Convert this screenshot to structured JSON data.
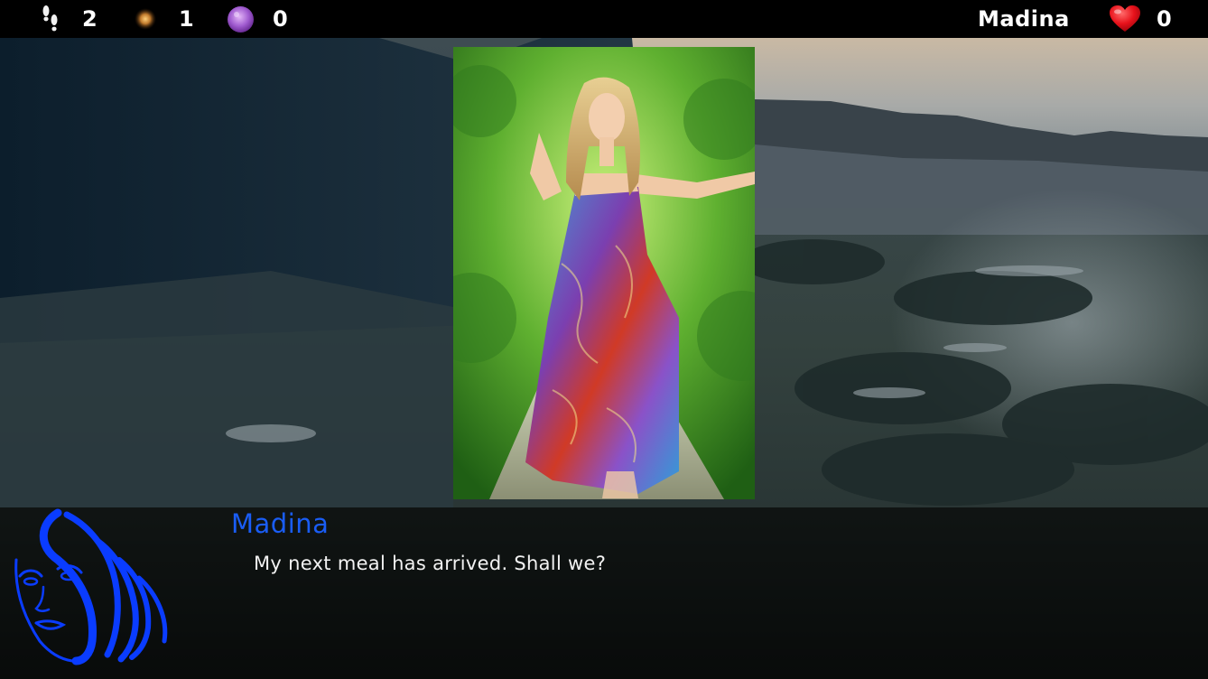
{
  "hud": {
    "steps": {
      "icon": "footsteps-icon",
      "value": "2"
    },
    "energy": {
      "icon": "sun-orb-icon",
      "value": "1"
    },
    "magic": {
      "icon": "purple-orb-icon",
      "value": "0"
    },
    "character_name": "Madina",
    "affection": {
      "icon": "heart-icon",
      "value": "0"
    }
  },
  "dialog": {
    "speaker": "Madina",
    "text": "My next meal has arrived. Shall we?"
  },
  "colors": {
    "speaker": "#1a5df5",
    "hud_bg": "#000000",
    "heart": "#e8121b",
    "side_image": "#0a3cff"
  }
}
